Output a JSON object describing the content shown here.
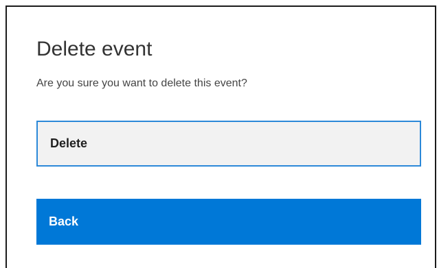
{
  "dialog": {
    "title": "Delete event",
    "message": "Are you sure you want to delete this event?",
    "delete_label": "Delete",
    "back_label": "Back"
  },
  "colors": {
    "primary_button": "#0078d7",
    "focus_border": "#2b88d8",
    "secondary_button": "#f2f2f2"
  }
}
